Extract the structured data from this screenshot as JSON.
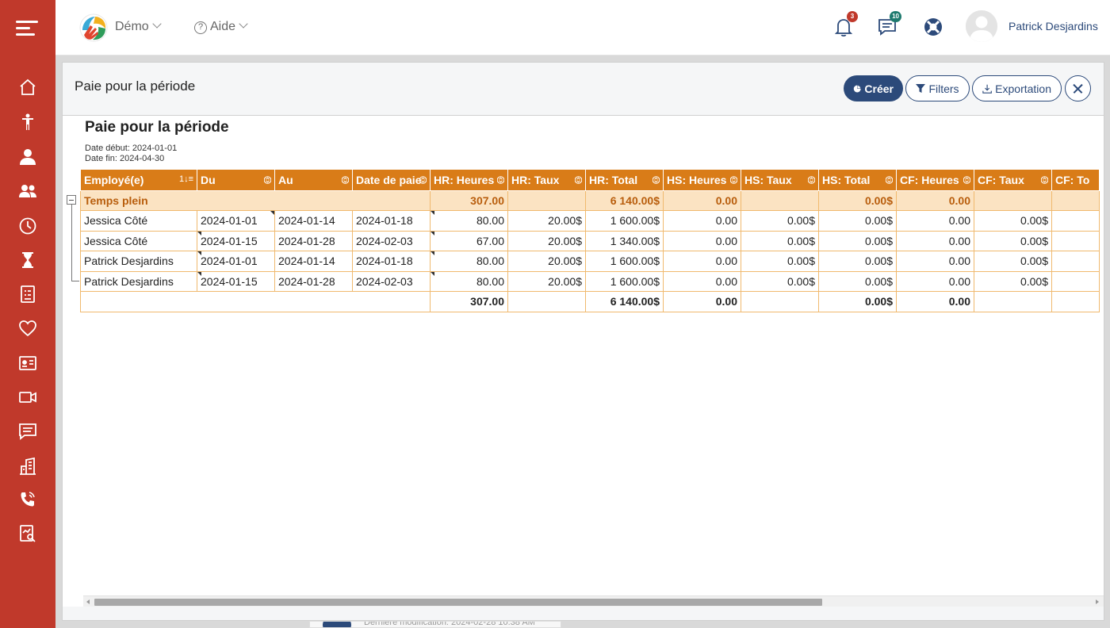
{
  "topbar": {
    "org_label": "Démo",
    "help_label": "Aide",
    "notifications_count": "3",
    "messages_count": "10",
    "user_name": "Patrick Desjardins"
  },
  "sidebar": {
    "items": [
      "menu-icon",
      "home-icon",
      "person-icon",
      "user-icon",
      "users-icon",
      "clock-icon",
      "hourglass-icon",
      "document-list-icon",
      "heart-icon",
      "id-card-icon",
      "video-icon",
      "chat-icon",
      "building-icon",
      "phone-icon",
      "report-icon"
    ]
  },
  "modal": {
    "title": "Paie pour la période",
    "create_label": "Créer",
    "filters_label": "Filters",
    "export_label": "Exportation"
  },
  "report": {
    "title": "Paie pour la période",
    "date_start": "Date début: 2024-01-01",
    "date_end": "Date fin: 2024-04-30",
    "columns": [
      "Employé(e)",
      "Du",
      "Au",
      "Date de paie",
      "HR: Heures",
      "HR: Taux",
      "HR: Total",
      "HS: Heures",
      "HS: Taux",
      "HS: Total",
      "CF: Heures",
      "CF: Taux",
      "CF: To"
    ],
    "group": {
      "label": "Temps plein",
      "hr_heures": "307.00",
      "hr_total": "6 140.00$",
      "hs_heures": "0.00",
      "hs_total": "0.00$",
      "cf_heures": "0.00"
    },
    "rows": [
      [
        "Jessica Côté",
        "2024-01-01",
        "2024-01-14",
        "2024-01-18",
        "80.00",
        "20.00$",
        "1 600.00$",
        "0.00",
        "0.00$",
        "0.00$",
        "0.00",
        "0.00$",
        ""
      ],
      [
        "Jessica Côté",
        "2024-01-15",
        "2024-01-28",
        "2024-02-03",
        "67.00",
        "20.00$",
        "1 340.00$",
        "0.00",
        "0.00$",
        "0.00$",
        "0.00",
        "0.00$",
        ""
      ],
      [
        "Patrick Desjardins",
        "2024-01-01",
        "2024-01-14",
        "2024-01-18",
        "80.00",
        "20.00$",
        "1 600.00$",
        "0.00",
        "0.00$",
        "0.00$",
        "0.00",
        "0.00$",
        ""
      ],
      [
        "Patrick Desjardins",
        "2024-01-15",
        "2024-01-28",
        "2024-02-03",
        "80.00",
        "20.00$",
        "1 600.00$",
        "0.00",
        "0.00$",
        "0.00$",
        "0.00",
        "0.00$",
        ""
      ]
    ],
    "totals": {
      "hr_heures": "307.00",
      "hr_total": "6 140.00$",
      "hs_heures": "0.00",
      "hs_total": "0.00$",
      "cf_heures": "0.00"
    }
  },
  "background": {
    "last_modified": "Dernière modification: 2024-02-28 10:38 AM"
  }
}
